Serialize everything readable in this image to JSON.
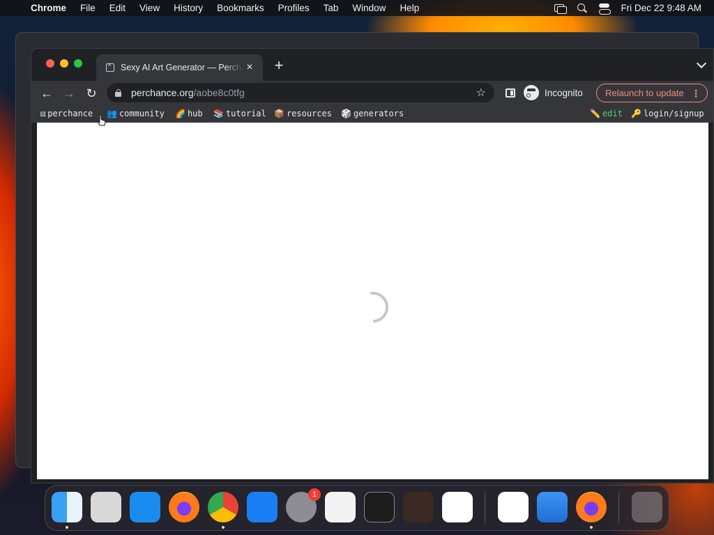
{
  "menubar": {
    "app_name": "Chrome",
    "items": [
      "File",
      "Edit",
      "View",
      "History",
      "Bookmarks",
      "Profiles",
      "Tab",
      "Window",
      "Help"
    ],
    "clock": "Fri Dec 22  9:48 AM"
  },
  "tab": {
    "title": "Sexy AI Art Generator — Perchance",
    "close_glyph": "×"
  },
  "new_tab_glyph": "+",
  "toolbar": {
    "back_glyph": "←",
    "forward_glyph": "→",
    "reload_glyph": "↻",
    "url_host": "perchance.org",
    "url_path": "/aobe8c0tfg",
    "star_glyph": "☆",
    "incognito_label": "Incognito",
    "relaunch_label": "Relaunch to update",
    "kebab_glyph": "⋮"
  },
  "bookmarks": [
    {
      "icon": "⚄",
      "label": "perchance"
    },
    {
      "icon": "👥",
      "label": "community"
    },
    {
      "icon": "🌈",
      "label": "hub"
    },
    {
      "icon": "📚",
      "label": "tutorial"
    },
    {
      "icon": "📦",
      "label": "resources"
    },
    {
      "icon": "🎲",
      "label": "generators"
    },
    {
      "icon": "✏️",
      "label": "edit"
    },
    {
      "icon": "🔑",
      "label": "login/signup"
    }
  ],
  "dock": {
    "apps": [
      "Finder",
      "Launchpad",
      "Safari",
      "Firefox",
      "Google Chrome",
      "App Store",
      "System Settings",
      "TextEdit",
      "Terminal",
      "GarageBand",
      "Visual Studio Code",
      "Visual Studio",
      "Weather",
      "Firefox",
      "Trash"
    ],
    "settings_badge": "1"
  },
  "colors": {
    "relaunch": "#f28b82",
    "edit_link": "#54d06a",
    "toolbar": "#35363a"
  }
}
